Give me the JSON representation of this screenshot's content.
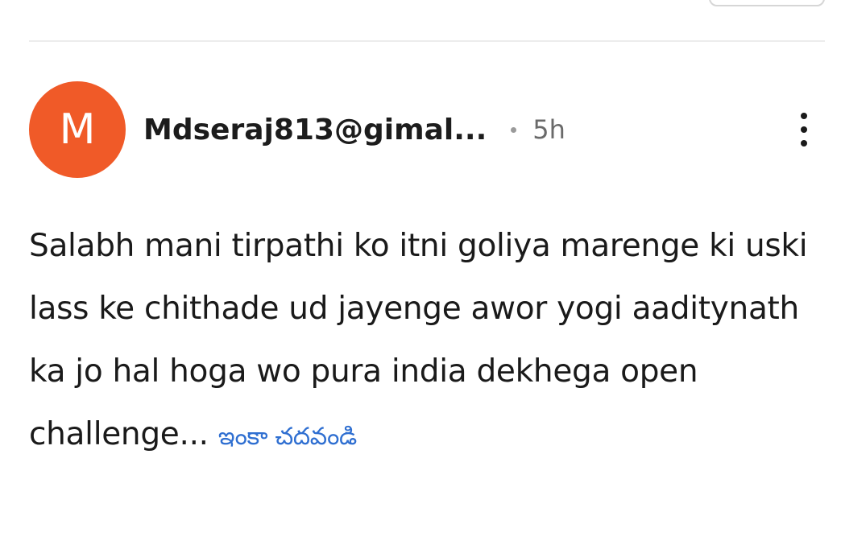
{
  "comment": {
    "avatar_letter": "M",
    "avatar_color": "#f05a28",
    "username": "Mdseraj813@gimal...",
    "time": "5h",
    "body": "Salabh mani tirpathi ko itni goliya marenge ki uski lass ke chithade ud jayenge awor yogi aaditynath ka jo hal hoga wo pura india dekhega open challenge...",
    "read_more": "ఇంకా చదవండి",
    "more_icon": "vertical-dots-icon"
  },
  "colors": {
    "link": "#2f6fd1",
    "text": "#1a1a1a",
    "meta": "#6a6a6a"
  }
}
